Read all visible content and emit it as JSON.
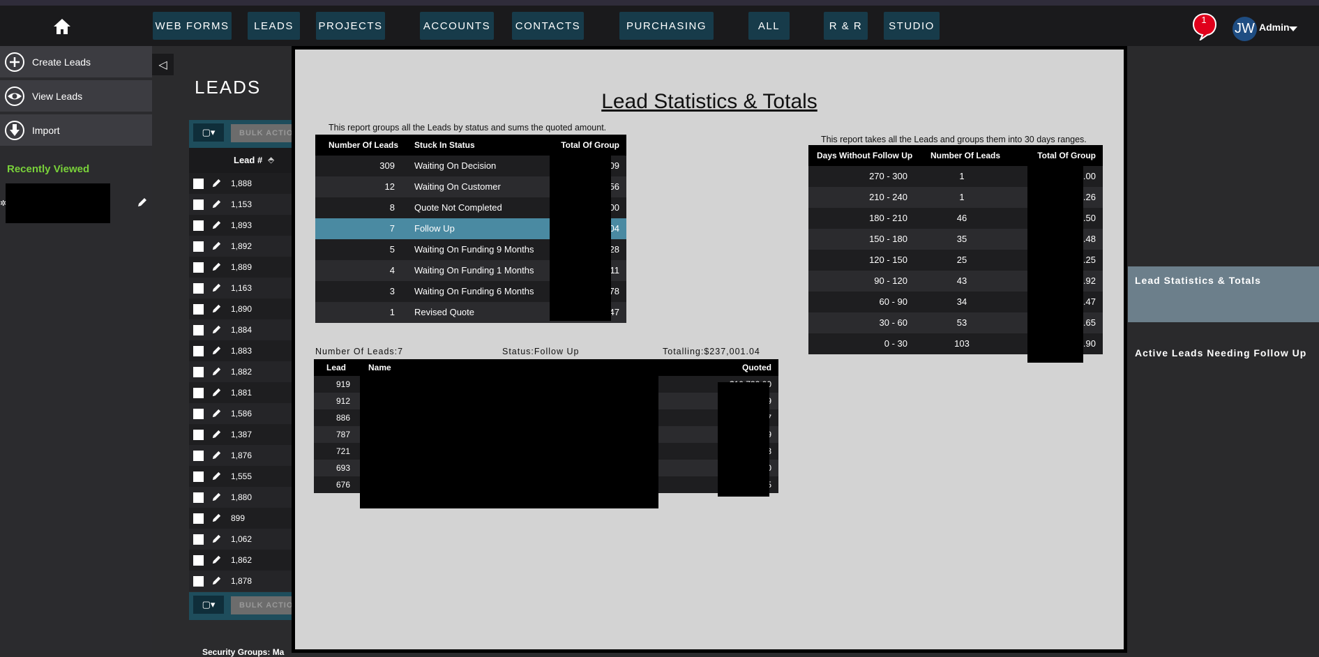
{
  "topnav": {
    "items": [
      "WEB FORMS",
      "LEADS",
      "PROJECTS",
      "ACCOUNTS",
      "CONTACTS",
      "PURCHASING",
      "ALL",
      "R & R",
      "STUDIO"
    ],
    "notifications": "1",
    "avatar_initials": "JW",
    "user": "Admin"
  },
  "sidebar": {
    "items": [
      {
        "label": "Create Leads",
        "icon": "plus-circle-icon"
      },
      {
        "label": "View Leads",
        "icon": "eye-icon"
      },
      {
        "label": "Import",
        "icon": "download-arrow-icon"
      }
    ],
    "recently_viewed": "Recently Viewed"
  },
  "leads_list": {
    "title": "LEADS",
    "bulk_label": "BULK ACTIONS",
    "column_header": "Lead #",
    "rows": [
      "1,888",
      "1,153",
      "1,893",
      "1,892",
      "1,889",
      "1,163",
      "1,890",
      "1,884",
      "1,883",
      "1,882",
      "1,881",
      "1,586",
      "1,387",
      "1,876",
      "1,555",
      "1,880",
      "899",
      "1,062",
      "1,862",
      "1,878"
    ],
    "footer_cut": "Security Groups: Ma"
  },
  "report": {
    "title": "Lead Statistics & Totals",
    "status_caption": "This report groups all the Leads by status and sums the quoted amount.",
    "status_headers": [
      "Number Of Leads",
      "Stuck In Status",
      "Total Of Group"
    ],
    "status_rows": [
      {
        "count": "309",
        "status": "Waiting On Decision",
        "total_tail": "09"
      },
      {
        "count": "12",
        "status": "Waiting On Customer",
        "total_tail": "56"
      },
      {
        "count": "8",
        "status": "Quote Not Completed",
        "total_tail": "00"
      },
      {
        "count": "7",
        "status": "Follow Up",
        "total_tail": "04"
      },
      {
        "count": "5",
        "status": "Waiting On Funding 9 Months",
        "total_tail": "28"
      },
      {
        "count": "4",
        "status": "Waiting On Funding 1 Months",
        "total_tail": "11"
      },
      {
        "count": "3",
        "status": "Waiting On Funding 6 Months",
        "total_tail": "78"
      },
      {
        "count": "1",
        "status": "Revised Quote",
        "total_tail": "47"
      }
    ],
    "range_caption": "This report takes all the Leads and groups them into 30 days ranges.",
    "range_headers": [
      "Days Without Follow Up",
      "Number Of Leads",
      "Total Of Group"
    ],
    "range_rows": [
      {
        "range": "270 - 300",
        "count": "1",
        "total_tail": ".00"
      },
      {
        "range": "210 - 240",
        "count": "1",
        "total_tail": ".26"
      },
      {
        "range": "180 - 210",
        "count": "46",
        "total_tail": ".50"
      },
      {
        "range": "150 - 180",
        "count": "35",
        "total_tail": ".48"
      },
      {
        "range": "120 - 150",
        "count": "25",
        "total_tail": ".25"
      },
      {
        "range": "90 - 120",
        "count": "43",
        "total_tail": ".92"
      },
      {
        "range": "60 - 90",
        "count": "34",
        "total_tail": ".47"
      },
      {
        "range": "30 - 60",
        "count": "53",
        "total_tail": ".65"
      },
      {
        "range": "0 - 30",
        "count": "103",
        "total_tail": ".90"
      }
    ],
    "detail_summary": {
      "count": "Number Of Leads:7",
      "status": "Status:Follow Up",
      "total": "Totalling:$237,001.04"
    },
    "detail_headers": [
      "Lead",
      "Name",
      "Quoted"
    ],
    "detail_rows": [
      {
        "lead": "919",
        "quoted_tail": "$10,732.00"
      },
      {
        "lead": "912",
        "quoted_tail": "9"
      },
      {
        "lead": "886",
        "quoted_tail": "7"
      },
      {
        "lead": "787",
        "quoted_tail": "9"
      },
      {
        "lead": "721",
        "quoted_tail": "3"
      },
      {
        "lead": "693",
        "quoted_tail": "0"
      },
      {
        "lead": "676",
        "quoted_tail": "5"
      }
    ]
  },
  "right_panel": {
    "items": [
      "Lead Statistics & Totals",
      "Active Leads Needing Follow Up"
    ]
  },
  "colors": {
    "nav_button": "#173b4a",
    "accent_green": "#79d13a",
    "highlight_row": "#4a8aa2",
    "notification_red": "#e0001b",
    "avatar_blue": "#1f4d82"
  }
}
